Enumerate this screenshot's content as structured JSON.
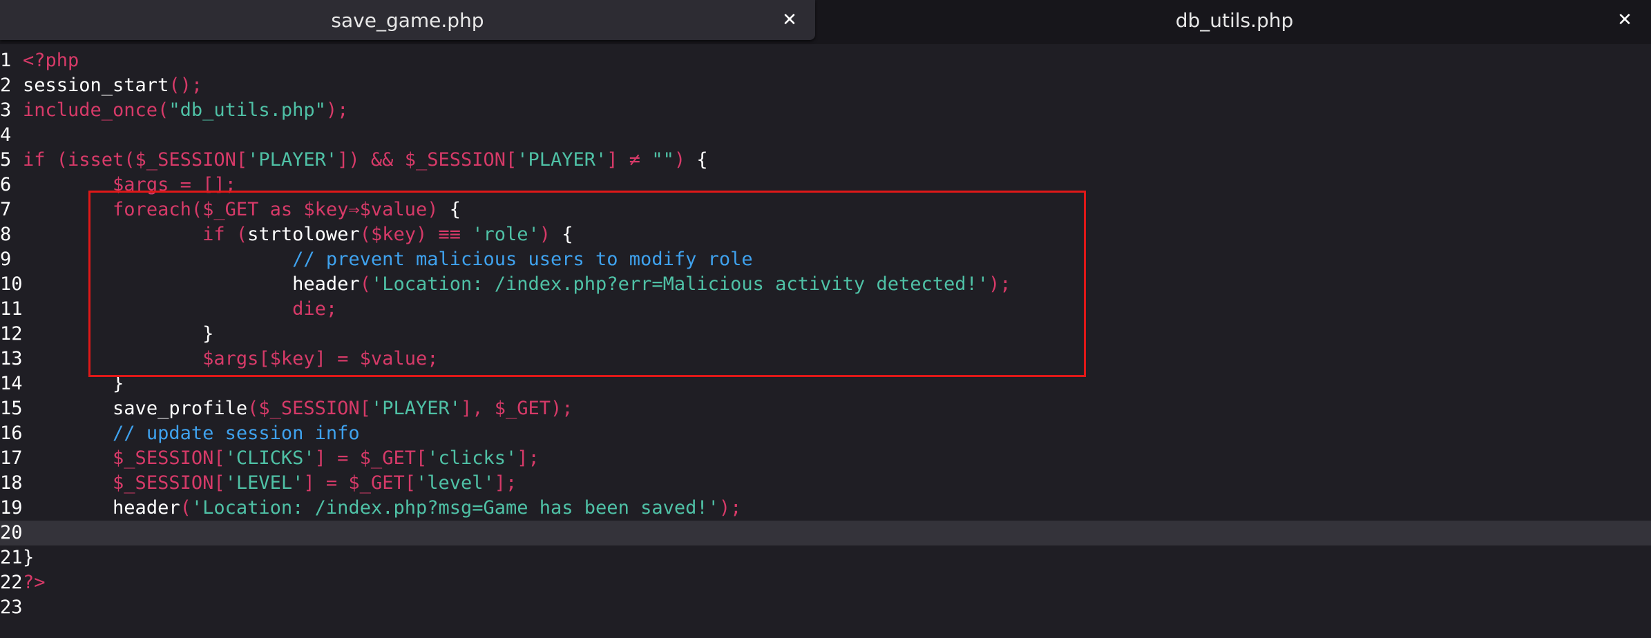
{
  "tabs": [
    {
      "label": "save_game.php",
      "close": "✕",
      "active": true
    },
    {
      "label": "db_utils.php",
      "close": "✕",
      "active": false
    }
  ],
  "colors": {
    "keyword": "#d63a68",
    "string": "#4fc1a6",
    "comment": "#3fa2ee",
    "plain": "#ffffff",
    "highlight_border": "#e01818",
    "current_line": "#34333a"
  },
  "editor": {
    "current_line": 20,
    "highlighted_lines": [
      7,
      13
    ],
    "lines": [
      {
        "n": "1",
        "tokens": [
          {
            "t": "kw",
            "v": "<?php"
          }
        ]
      },
      {
        "n": "2",
        "tokens": [
          {
            "t": "fn",
            "v": "session_start"
          },
          {
            "t": "kw",
            "v": "();"
          }
        ]
      },
      {
        "n": "3",
        "tokens": [
          {
            "t": "kw",
            "v": "include_once("
          },
          {
            "t": "str",
            "v": "\"db_utils.php\""
          },
          {
            "t": "kw",
            "v": ");"
          }
        ]
      },
      {
        "n": "4",
        "tokens": []
      },
      {
        "n": "5",
        "tokens": [
          {
            "t": "kw",
            "v": "if (isset($_SESSION["
          },
          {
            "t": "str",
            "v": "'PLAYER'"
          },
          {
            "t": "kw",
            "v": "]) && $_SESSION["
          },
          {
            "t": "str",
            "v": "'PLAYER'"
          },
          {
            "t": "kw",
            "v": "] ≠ "
          },
          {
            "t": "str",
            "v": "\"\""
          },
          {
            "t": "kw",
            "v": ") "
          },
          {
            "t": "pl",
            "v": "{"
          }
        ]
      },
      {
        "n": "6",
        "tokens": [
          {
            "t": "pl",
            "v": "        "
          },
          {
            "t": "var",
            "v": "$args = [];"
          }
        ]
      },
      {
        "n": "7",
        "tokens": [
          {
            "t": "pl",
            "v": "        "
          },
          {
            "t": "kw",
            "v": "foreach($_GET as $key⇒$value) "
          },
          {
            "t": "pl",
            "v": "{"
          }
        ]
      },
      {
        "n": "8",
        "tokens": [
          {
            "t": "pl",
            "v": "                "
          },
          {
            "t": "kw",
            "v": "if ("
          },
          {
            "t": "fn",
            "v": "strtolower"
          },
          {
            "t": "kw",
            "v": "($key) ≡≡ "
          },
          {
            "t": "str",
            "v": "'role'"
          },
          {
            "t": "kw",
            "v": ") "
          },
          {
            "t": "pl",
            "v": "{"
          }
        ]
      },
      {
        "n": "9",
        "tokens": [
          {
            "t": "pl",
            "v": "                        "
          },
          {
            "t": "cm",
            "v": "// prevent malicious users to modify role"
          }
        ]
      },
      {
        "n": "10",
        "tokens": [
          {
            "t": "pl",
            "v": "                        "
          },
          {
            "t": "fn",
            "v": "header"
          },
          {
            "t": "kw",
            "v": "("
          },
          {
            "t": "str",
            "v": "'Location: /index.php?err=Malicious activity detected!'"
          },
          {
            "t": "kw",
            "v": ");"
          }
        ]
      },
      {
        "n": "11",
        "tokens": [
          {
            "t": "pl",
            "v": "                        "
          },
          {
            "t": "kw",
            "v": "die;"
          }
        ]
      },
      {
        "n": "12",
        "tokens": [
          {
            "t": "pl",
            "v": "                }"
          }
        ]
      },
      {
        "n": "13",
        "tokens": [
          {
            "t": "pl",
            "v": "                "
          },
          {
            "t": "var",
            "v": "$args[$key] = $value;"
          }
        ]
      },
      {
        "n": "14",
        "tokens": [
          {
            "t": "pl",
            "v": "        }"
          }
        ]
      },
      {
        "n": "15",
        "tokens": [
          {
            "t": "pl",
            "v": "        "
          },
          {
            "t": "fn",
            "v": "save_profile"
          },
          {
            "t": "kw",
            "v": "($_SESSION["
          },
          {
            "t": "str",
            "v": "'PLAYER'"
          },
          {
            "t": "kw",
            "v": "], $_GET);"
          }
        ]
      },
      {
        "n": "16",
        "tokens": [
          {
            "t": "pl",
            "v": "        "
          },
          {
            "t": "cm",
            "v": "// update session info"
          }
        ]
      },
      {
        "n": "17",
        "tokens": [
          {
            "t": "pl",
            "v": "        "
          },
          {
            "t": "kw",
            "v": "$_SESSION["
          },
          {
            "t": "str",
            "v": "'CLICKS'"
          },
          {
            "t": "kw",
            "v": "] = $_GET["
          },
          {
            "t": "str",
            "v": "'clicks'"
          },
          {
            "t": "kw",
            "v": "];"
          }
        ]
      },
      {
        "n": "18",
        "tokens": [
          {
            "t": "pl",
            "v": "        "
          },
          {
            "t": "kw",
            "v": "$_SESSION["
          },
          {
            "t": "str",
            "v": "'LEVEL'"
          },
          {
            "t": "kw",
            "v": "] = $_GET["
          },
          {
            "t": "str",
            "v": "'level'"
          },
          {
            "t": "kw",
            "v": "];"
          }
        ]
      },
      {
        "n": "19",
        "tokens": [
          {
            "t": "pl",
            "v": "        "
          },
          {
            "t": "fn",
            "v": "header"
          },
          {
            "t": "kw",
            "v": "("
          },
          {
            "t": "str",
            "v": "'Location: /index.php?msg=Game has been saved!'"
          },
          {
            "t": "kw",
            "v": ");"
          }
        ]
      },
      {
        "n": "20",
        "tokens": []
      },
      {
        "n": "21",
        "tokens": [
          {
            "t": "pl",
            "v": "}"
          }
        ]
      },
      {
        "n": "22",
        "tokens": [
          {
            "t": "kw",
            "v": "?>"
          }
        ]
      },
      {
        "n": "23",
        "tokens": []
      }
    ]
  }
}
